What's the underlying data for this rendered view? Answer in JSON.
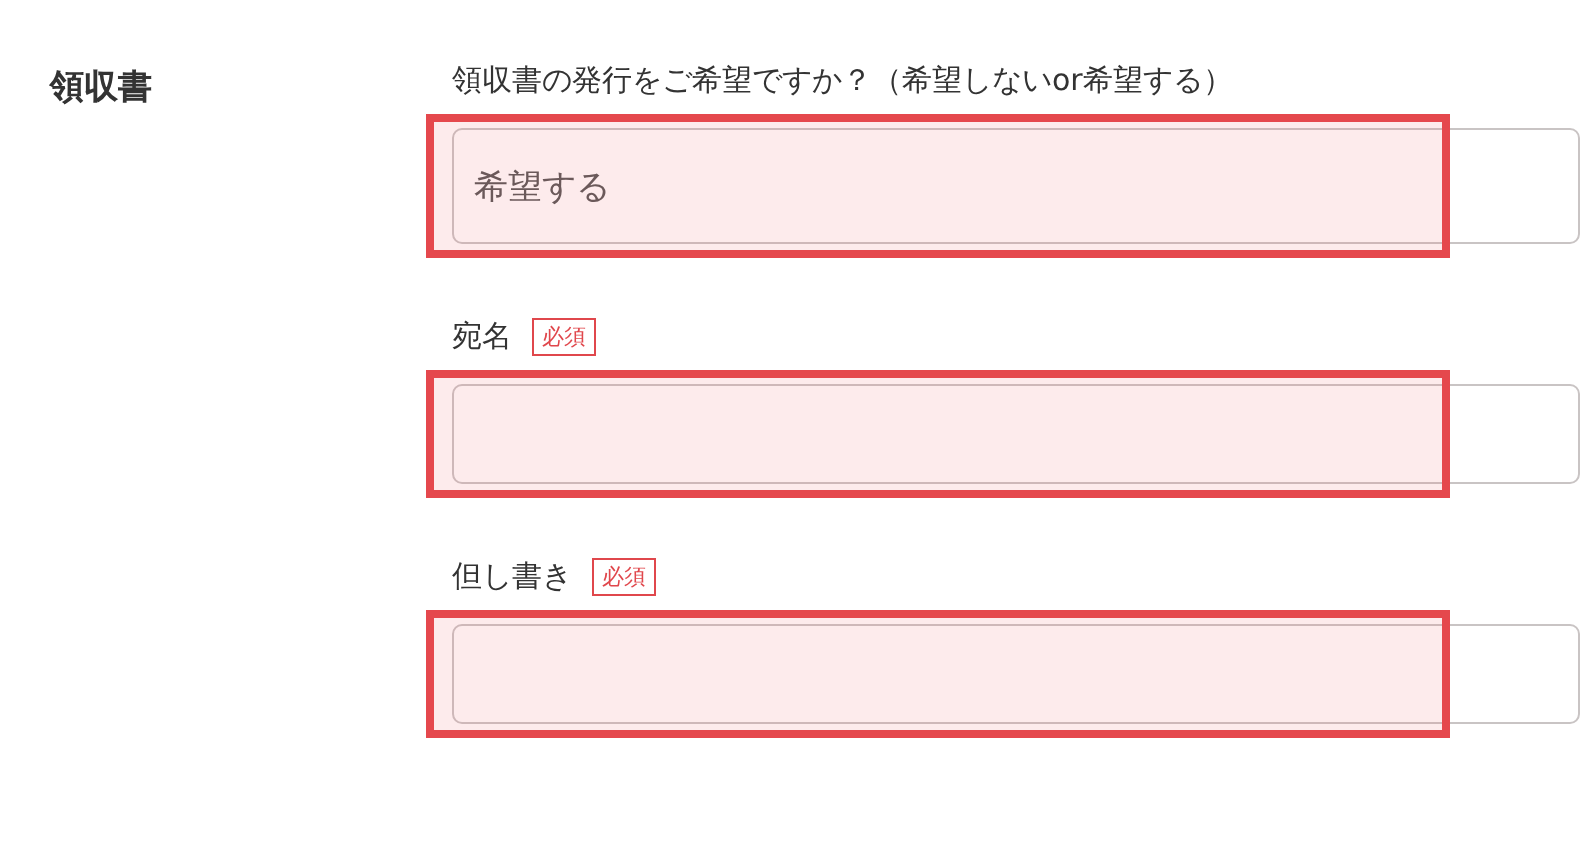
{
  "section": {
    "title": "領収書"
  },
  "fields": [
    {
      "kind": "select",
      "label": "領収書の発行をご希望ですか？（希望しないor希望する）",
      "value": "希望する",
      "highlighted": true
    },
    {
      "kind": "text",
      "label": "宛名",
      "badge": "必須",
      "highlighted": true
    },
    {
      "kind": "text",
      "label": "但し書き",
      "badge": "必須",
      "highlighted": true
    }
  ]
}
